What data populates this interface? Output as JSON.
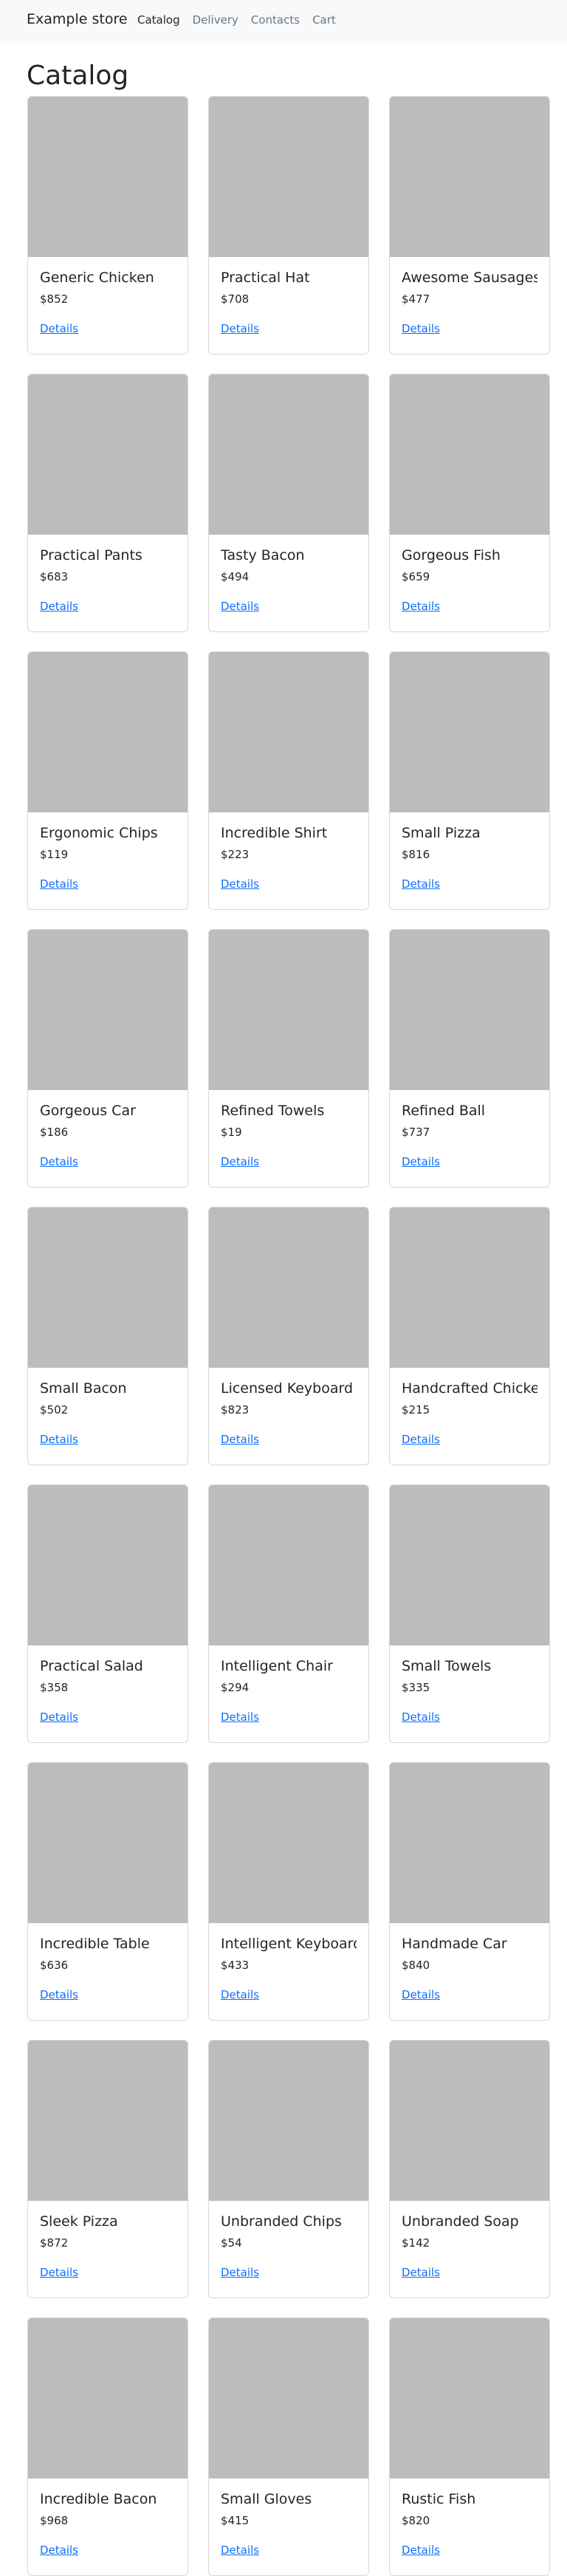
{
  "nav": {
    "brand": "Example store",
    "links": [
      {
        "label": "Catalog",
        "active": true
      },
      {
        "label": "Delivery",
        "active": false
      },
      {
        "label": "Contacts",
        "active": false
      },
      {
        "label": "Cart",
        "active": false
      }
    ]
  },
  "page_title": "Catalog",
  "details_label": "Details",
  "products": [
    {
      "name": "Generic Chicken",
      "price": "$852"
    },
    {
      "name": "Practical Hat",
      "price": "$708"
    },
    {
      "name": "Awesome Sausages",
      "price": "$477"
    },
    {
      "name": "Practical Pants",
      "price": "$683"
    },
    {
      "name": "Tasty Bacon",
      "price": "$494"
    },
    {
      "name": "Gorgeous Fish",
      "price": "$659"
    },
    {
      "name": "Ergonomic Chips",
      "price": "$119"
    },
    {
      "name": "Incredible Shirt",
      "price": "$223"
    },
    {
      "name": "Small Pizza",
      "price": "$816"
    },
    {
      "name": "Gorgeous Car",
      "price": "$186"
    },
    {
      "name": "Refined Towels",
      "price": "$19"
    },
    {
      "name": "Refined Ball",
      "price": "$737"
    },
    {
      "name": "Small Bacon",
      "price": "$502"
    },
    {
      "name": "Licensed Keyboard",
      "price": "$823"
    },
    {
      "name": "Handcrafted Chicken",
      "price": "$215"
    },
    {
      "name": "Practical Salad",
      "price": "$358"
    },
    {
      "name": "Intelligent Chair",
      "price": "$294"
    },
    {
      "name": "Small Towels",
      "price": "$335"
    },
    {
      "name": "Incredible Table",
      "price": "$636"
    },
    {
      "name": "Intelligent Keyboard",
      "price": "$433"
    },
    {
      "name": "Handmade Car",
      "price": "$840"
    },
    {
      "name": "Sleek Pizza",
      "price": "$872"
    },
    {
      "name": "Unbranded Chips",
      "price": "$54"
    },
    {
      "name": "Unbranded Soap",
      "price": "$142"
    },
    {
      "name": "Incredible Bacon",
      "price": "$968"
    },
    {
      "name": "Small Gloves",
      "price": "$415"
    },
    {
      "name": "Rustic Fish",
      "price": "$820"
    }
  ]
}
